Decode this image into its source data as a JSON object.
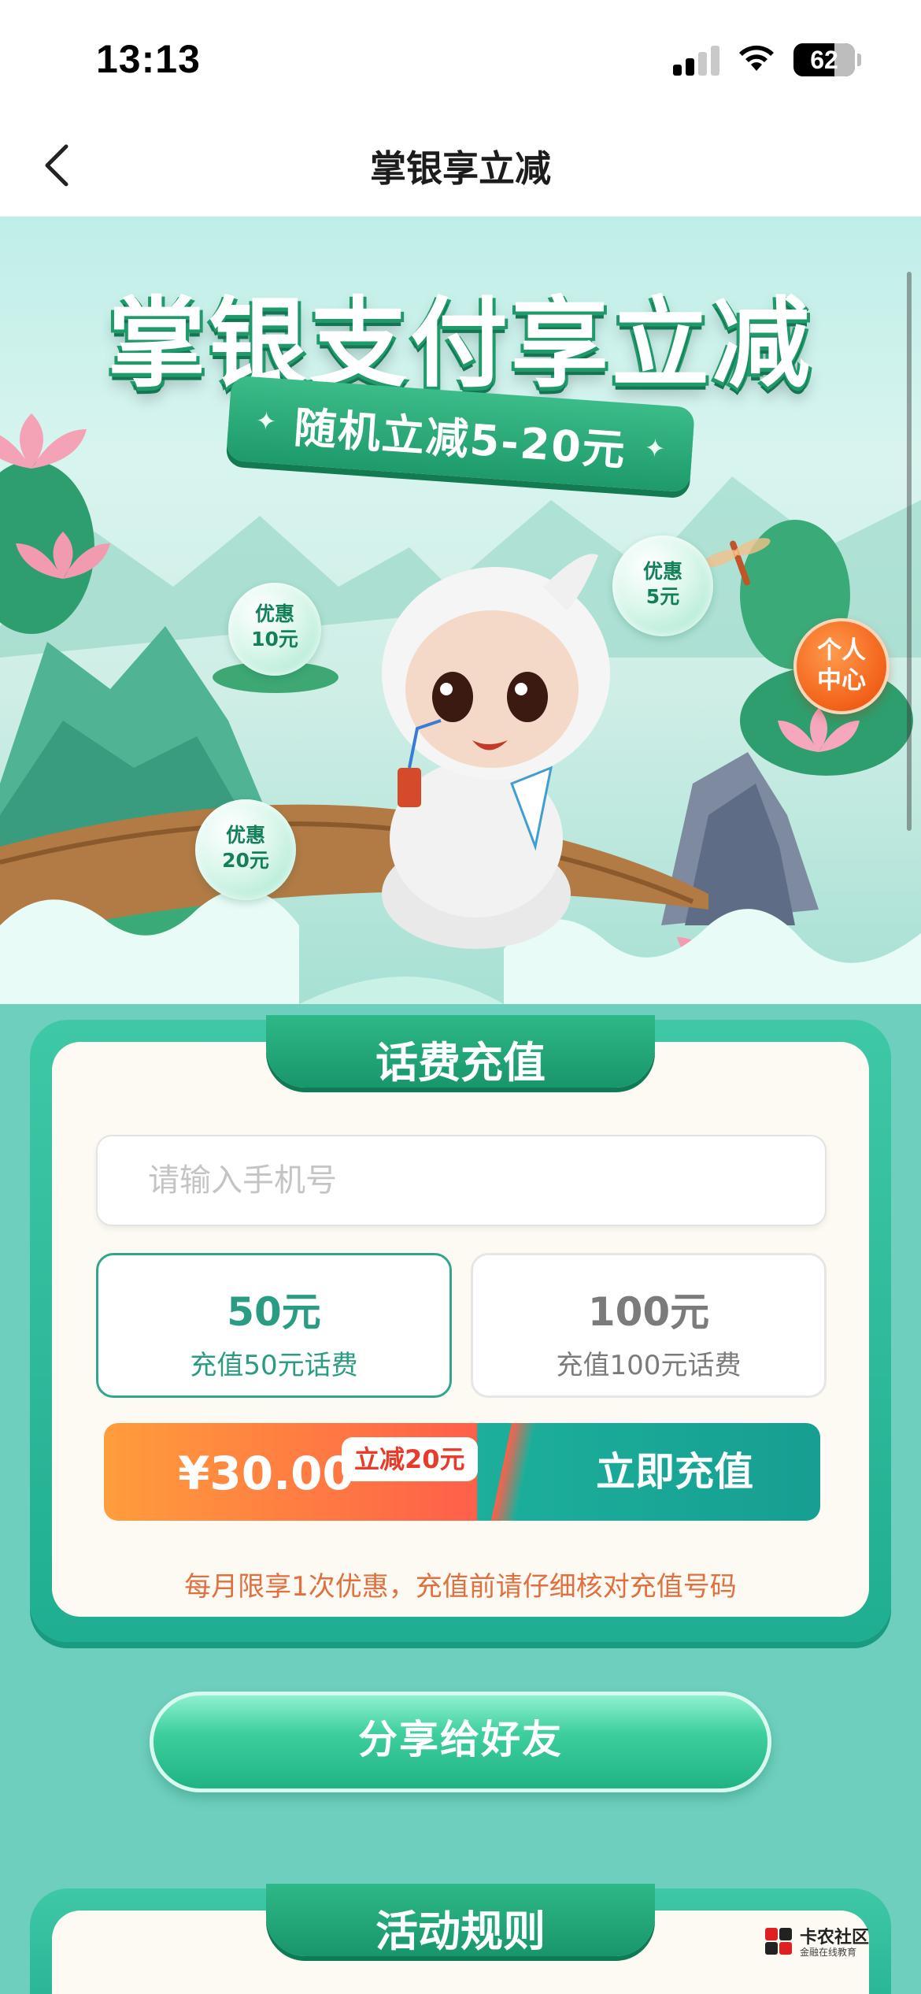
{
  "status_bar": {
    "time": "13:13",
    "battery": "62"
  },
  "nav": {
    "title": "掌银享立减"
  },
  "banner": {
    "headline": "掌银支付享立减",
    "ribbon": "随机立减5-20元",
    "bubbles": [
      {
        "line1": "优惠",
        "line2": "10元"
      },
      {
        "line1": "优惠",
        "line2": "5元"
      },
      {
        "line1": "优惠",
        "line2": "20元"
      }
    ],
    "personal_center": {
      "line1": "个人",
      "line2": "中心"
    }
  },
  "recharge": {
    "section_title": "话费充值",
    "phone_placeholder": "请输入手机号",
    "options": [
      {
        "amount": "50元",
        "desc": "充值50元话费",
        "selected": true
      },
      {
        "amount": "100元",
        "desc": "充值100元话费",
        "selected": false
      }
    ],
    "price": "¥30.00",
    "discount_badge": "立减20元",
    "button": "立即充值",
    "notice": "每月限享1次优惠，充值前请仔细核对充值号码"
  },
  "share": {
    "label": "分享给好友"
  },
  "rules": {
    "title": "活动规则"
  },
  "watermark": {
    "title": "卡农社区",
    "subtitle": "金融在线教育"
  },
  "colors": {
    "accent": "#1fae91",
    "orange": "#ff7a3d",
    "notice": "#e0703e"
  }
}
